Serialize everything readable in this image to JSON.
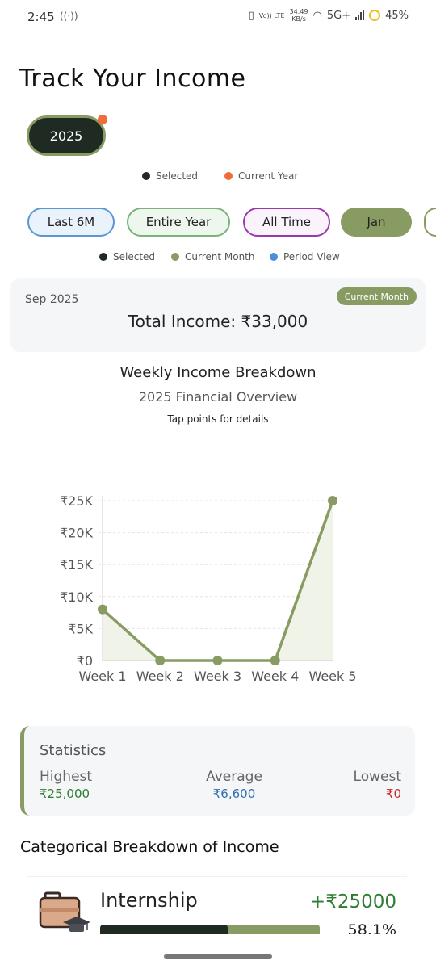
{
  "status_bar": {
    "time": "2:45",
    "speed_value": "34.49",
    "speed_unit": "KB/s",
    "volte": "Vo)) LTE",
    "network": "5G+",
    "battery": "45%"
  },
  "page_title": "Track Your Income",
  "year_selector": {
    "selected": "2025"
  },
  "year_legend": {
    "selected": "Selected",
    "current_year": "Current Year"
  },
  "filters": {
    "last_6m": "Last 6M",
    "entire_year": "Entire Year",
    "all_time": "All Time",
    "month": "Jan"
  },
  "filter_legend": {
    "selected": "Selected",
    "current_month": "Current Month",
    "period_view": "Period View"
  },
  "income_card": {
    "period": "Sep 2025",
    "badge": "Current Month",
    "total": "Total Income: ₹33,000"
  },
  "chart_header": {
    "title": "Weekly Income Breakdown",
    "subtitle": "2025 Financial Overview",
    "hint": "Tap points for details"
  },
  "chart_data": {
    "type": "line",
    "categories": [
      "Week 1",
      "Week 2",
      "Week 3",
      "Week 4",
      "Week 5"
    ],
    "values": [
      8000,
      0,
      0,
      0,
      25000
    ],
    "ylim": [
      0,
      25000
    ],
    "y_ticks": [
      0,
      5000,
      10000,
      15000,
      20000,
      25000
    ],
    "y_tick_labels": [
      "₹0",
      "₹5K",
      "₹10K",
      "₹15K",
      "₹20K",
      "₹25K"
    ],
    "grid": true,
    "area_fill": true,
    "colors": {
      "line": "#889b62",
      "point": "#889b62",
      "fill": "#eef2e6",
      "grid": "#e4e4e4",
      "axis": "#cfcfcf"
    }
  },
  "statistics": {
    "title": "Statistics",
    "highest_label": "Highest",
    "highest_value": "₹25,000",
    "average_label": "Average",
    "average_value": "₹6,600",
    "lowest_label": "Lowest",
    "lowest_value": "₹0"
  },
  "breakdown": {
    "title": "Categorical Breakdown of Income",
    "items": [
      {
        "name": "Internship",
        "amount": "+₹25000",
        "percent": "58.1%",
        "fraction": 0.581,
        "icon": "briefcase-graduation-icon"
      }
    ]
  },
  "colors": {
    "accent": "#889b62",
    "dark": "#1f2a22",
    "current_year_dot": "#f36b3b",
    "period_view_dot": "#4a8fd8",
    "positive": "#2e7d32",
    "average": "#2f6fb0",
    "negative": "#c62828"
  }
}
